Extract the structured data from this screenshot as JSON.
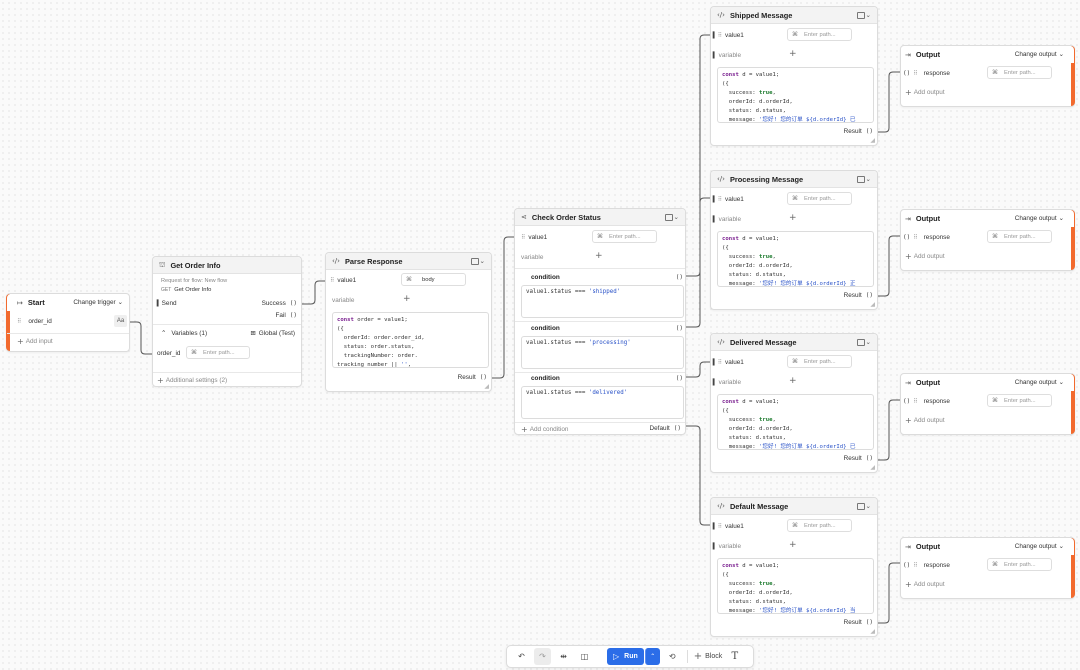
{
  "colors": {
    "accent": "#f26a2e",
    "run": "#2b6de8",
    "wire": "#555555"
  },
  "start": {
    "title": "Start",
    "change_label": "Change trigger",
    "input_name": "order_id",
    "type_badge": "Aa",
    "add_input": "Add input"
  },
  "get_order": {
    "title": "Get Order Info",
    "request_for": "Request for flow: New flow",
    "method": "GET",
    "request_name": "Get Order Info",
    "send": "Send",
    "success": "Success",
    "fail": "Fail",
    "variables": "Variables (1)",
    "global": "Global (Test)",
    "var_name": "order_id",
    "var_placeholder": "Enter path...",
    "additional": "Additional settings (2)"
  },
  "parse": {
    "title": "Parse Response",
    "value_label": "value1",
    "value_binding": "body",
    "variable_placeholder": "variable",
    "result": "Result",
    "code": [
      "const order = value1;",
      "({",
      "  orderId: order.order_id,",
      "  status: order.status,",
      "  trackingNumber: order.",
      "tracking_number || '',"
    ]
  },
  "check": {
    "title": "Check Order Status",
    "value_label": "value1",
    "value_placeholder": "Enter path...",
    "variable_placeholder": "variable",
    "condition_label": "condition",
    "conditions": [
      {
        "prefix": "value1.status === ",
        "literal": "'shipped'"
      },
      {
        "prefix": "value1.status === ",
        "literal": "'processing'"
      },
      {
        "prefix": "value1.status === ",
        "literal": "'delivered'"
      }
    ],
    "add_condition": "Add condition",
    "default": "Default"
  },
  "messages": [
    {
      "title": "Shipped Message",
      "msg": "'您好! 您的订单 ${d.orderId} 已"
    },
    {
      "title": "Processing Message",
      "msg": "'您好! 您的订单 ${d.orderId} 正"
    },
    {
      "title": "Delivered Message",
      "msg": "'您好! 您的订单 ${d.orderId} 已"
    },
    {
      "title": "Default Message",
      "msg": "'您好! 您的订单 ${d.orderId} 当"
    }
  ],
  "message_common": {
    "value_label": "value1",
    "placeholder": "Enter path...",
    "variable_placeholder": "variable",
    "result": "Result"
  },
  "output": {
    "title": "Output",
    "change_label": "Change output",
    "response": "response",
    "placeholder": "Enter path...",
    "add_output": "Add output"
  },
  "toolbar": {
    "run": "Run",
    "block": "Block"
  }
}
